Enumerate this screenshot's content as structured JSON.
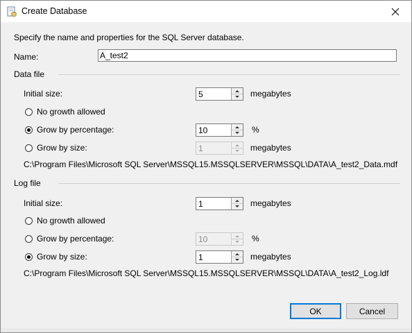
{
  "window": {
    "title": "Create Database"
  },
  "intro": "Specify the name and properties for the SQL Server database.",
  "name": {
    "label": "Name:",
    "value": "A_test2"
  },
  "data_file": {
    "group_label": "Data file",
    "initial_size_label": "Initial size:",
    "initial_size_value": "5",
    "initial_size_unit": "megabytes",
    "no_growth_label": "No growth allowed",
    "grow_pct_label": "Grow by percentage:",
    "grow_pct_value": "10",
    "grow_pct_unit": "%",
    "grow_size_label": "Grow by size:",
    "grow_size_value": "1",
    "grow_size_unit": "megabytes",
    "selected": "percentage",
    "path": "C:\\Program Files\\Microsoft SQL Server\\MSSQL15.MSSQLSERVER\\MSSQL\\DATA\\A_test2_Data.mdf"
  },
  "log_file": {
    "group_label": "Log file",
    "initial_size_label": "Initial size:",
    "initial_size_value": "1",
    "initial_size_unit": "megabytes",
    "no_growth_label": "No growth allowed",
    "grow_pct_label": "Grow by percentage:",
    "grow_pct_value": "10",
    "grow_pct_unit": "%",
    "grow_size_label": "Grow by size:",
    "grow_size_value": "1",
    "grow_size_unit": "megabytes",
    "selected": "size",
    "path": "C:\\Program Files\\Microsoft SQL Server\\MSSQL15.MSSQLSERVER\\MSSQL\\DATA\\A_test2_Log.ldf"
  },
  "buttons": {
    "ok": "OK",
    "cancel": "Cancel"
  },
  "icons": {
    "title": "database-icon",
    "close": "close-icon"
  },
  "colors": {
    "default_button_border": "#0078d7",
    "background": "#f0f0f0"
  }
}
